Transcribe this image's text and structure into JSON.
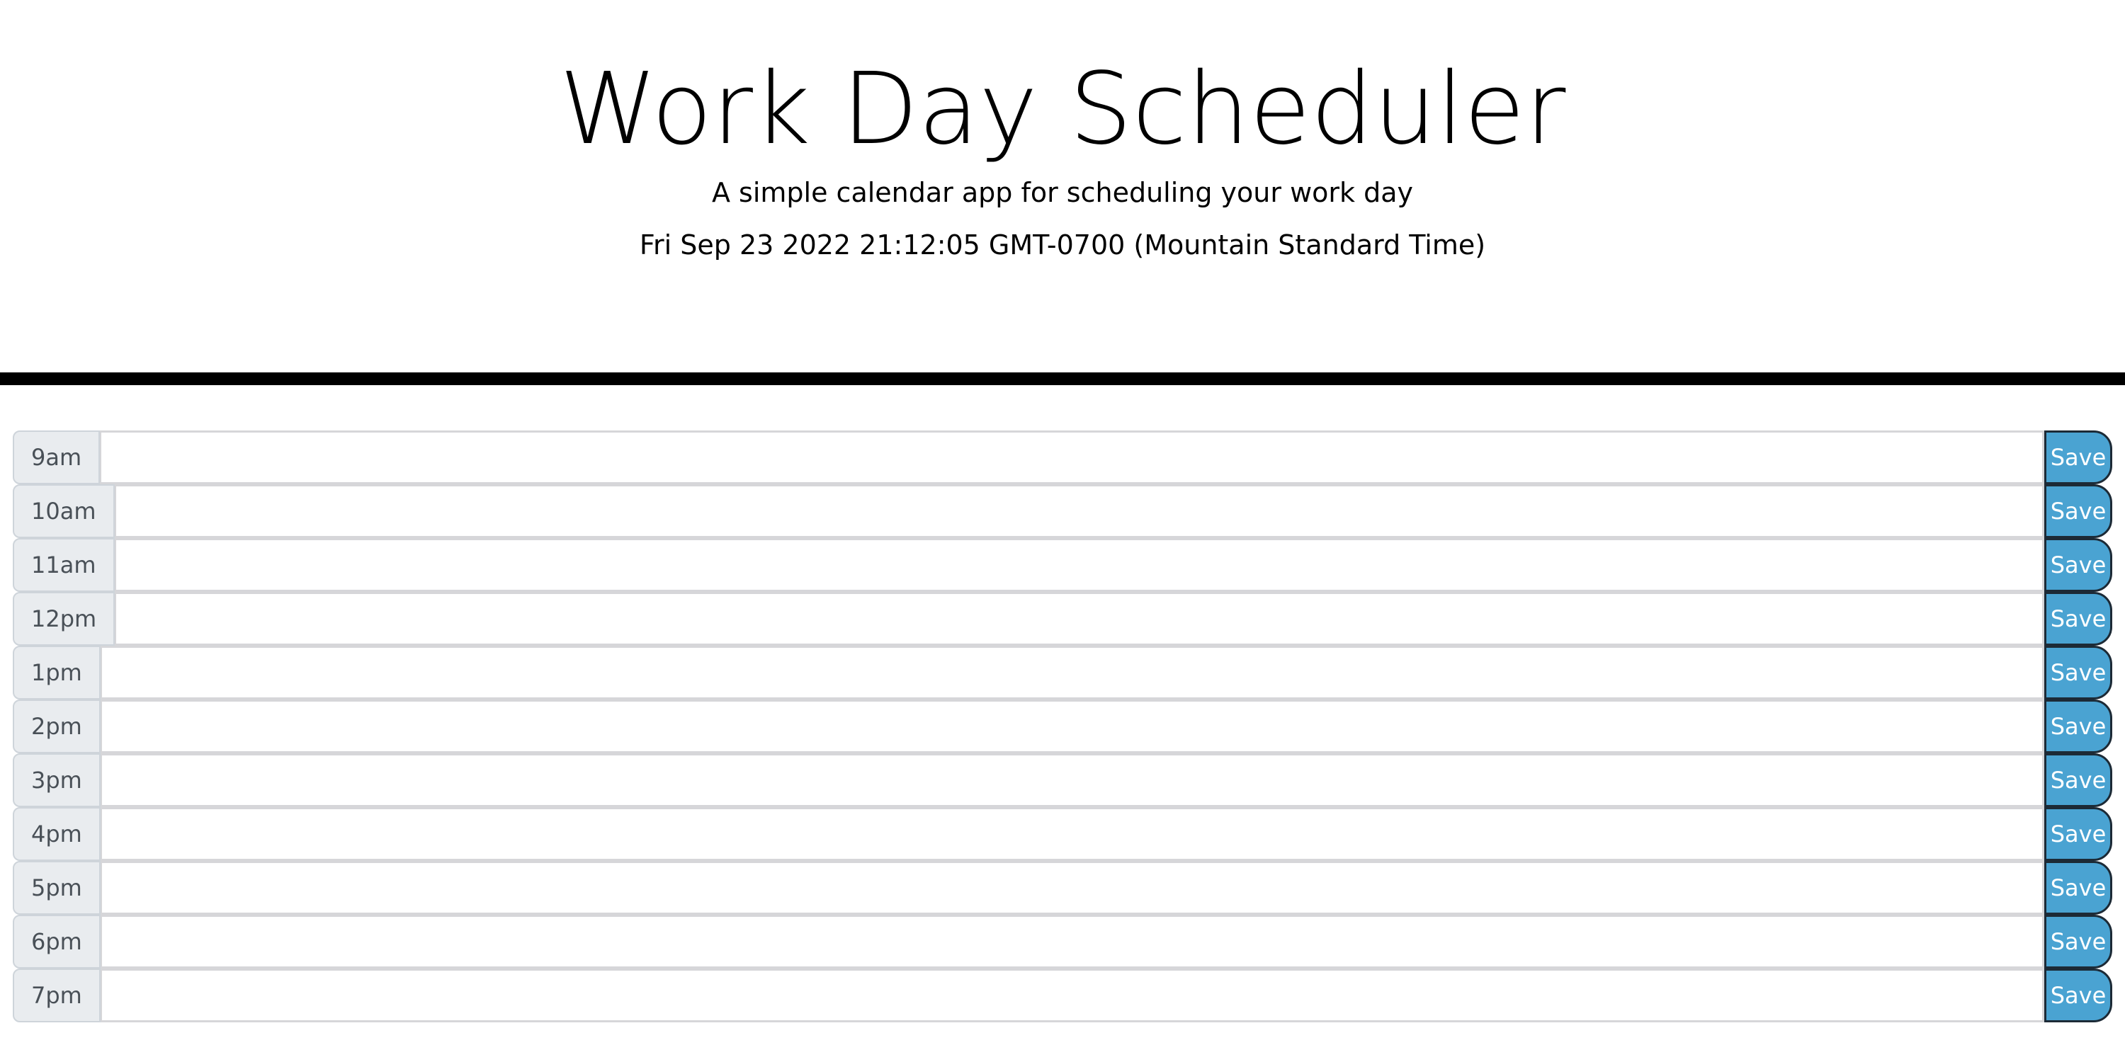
{
  "header": {
    "title": "Work Day Scheduler",
    "subtitle": "A simple calendar app for scheduling your work day",
    "current_day": "Fri Sep 23 2022 21:12:05 GMT-0700 (Mountain Standard Time)"
  },
  "schedule": {
    "save_label": "Save",
    "hours": [
      {
        "label": "9am",
        "text": ""
      },
      {
        "label": "10am",
        "text": ""
      },
      {
        "label": "11am",
        "text": ""
      },
      {
        "label": "12pm",
        "text": ""
      },
      {
        "label": "1pm",
        "text": ""
      },
      {
        "label": "2pm",
        "text": ""
      },
      {
        "label": "3pm",
        "text": ""
      },
      {
        "label": "4pm",
        "text": ""
      },
      {
        "label": "5pm",
        "text": ""
      },
      {
        "label": "6pm",
        "text": ""
      },
      {
        "label": "7pm",
        "text": ""
      }
    ]
  },
  "colors": {
    "save_button": "#4aa3d2",
    "hour_background": "#e9ecef",
    "divider": "#000000"
  }
}
